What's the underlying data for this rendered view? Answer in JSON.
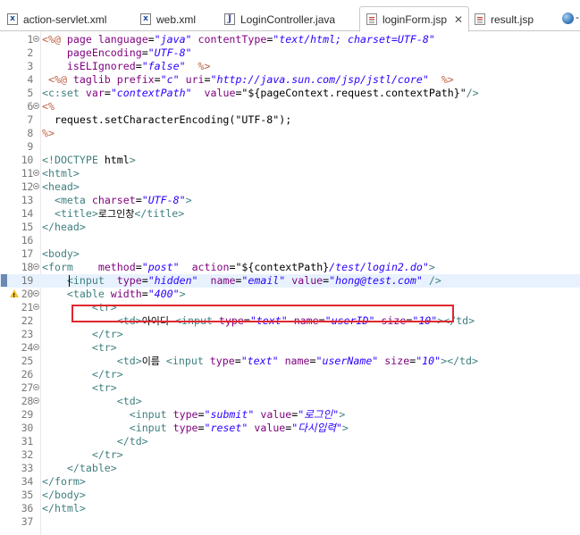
{
  "tabs": [
    {
      "label": "action-servlet.xml",
      "icon": "xml-file-icon",
      "active": false
    },
    {
      "label": "web.xml",
      "icon": "xml-file-icon",
      "active": false
    },
    {
      "label": "LoginController.java",
      "icon": "java-file-icon",
      "active": false
    },
    {
      "label": "loginForm.jsp",
      "icon": "jsp-file-icon",
      "active": true,
      "close": "✕"
    },
    {
      "label": "result.jsp",
      "icon": "jsp-file-icon",
      "active": false
    }
  ],
  "overflow_tab_icon": "web-browser-globe-icon",
  "overflow_mark": "-",
  "editor": {
    "current_line": 19,
    "warning_line": 20,
    "highlighted_line": 19,
    "highlight_color": "#e0262e",
    "lines": [
      {
        "n": "1",
        "fold": true,
        "spans": [
          [
            "jsp",
            "<%@ "
          ],
          [
            "attr",
            "page "
          ],
          [
            "attr",
            "language"
          ],
          [
            "p",
            "="
          ],
          [
            "val",
            "\"java\""
          ],
          [
            "p",
            " "
          ],
          [
            "attr",
            "contentType"
          ],
          [
            "p",
            "="
          ],
          [
            "val",
            "\"text/html; charset=UTF-8\""
          ]
        ]
      },
      {
        "n": "2",
        "spans": [
          [
            "p",
            "    "
          ],
          [
            "attr",
            "pageEncoding"
          ],
          [
            "p",
            "="
          ],
          [
            "val",
            "\"UTF-8\""
          ]
        ]
      },
      {
        "n": "3",
        "spans": [
          [
            "p",
            "    "
          ],
          [
            "attr",
            "isELIgnored"
          ],
          [
            "p",
            "="
          ],
          [
            "val",
            "\"false\""
          ],
          [
            "p",
            "  "
          ],
          [
            "jsp",
            "%>"
          ]
        ]
      },
      {
        "n": "4",
        "spans": [
          [
            "p",
            " "
          ],
          [
            "jsp",
            "<%@ "
          ],
          [
            "attr",
            "taglib "
          ],
          [
            "attr",
            "prefix"
          ],
          [
            "p",
            "="
          ],
          [
            "val",
            "\"c\""
          ],
          [
            "p",
            " "
          ],
          [
            "attr",
            "uri"
          ],
          [
            "p",
            "="
          ],
          [
            "val",
            "\"http://java.sun.com/jsp/jstl/core\""
          ],
          [
            "p",
            "  "
          ],
          [
            "jsp",
            "%>"
          ]
        ]
      },
      {
        "n": "5",
        "spans": [
          [
            "tag",
            "<c:set "
          ],
          [
            "attr",
            "var"
          ],
          [
            "p",
            "="
          ],
          [
            "val",
            "\"contextPath\""
          ],
          [
            "p",
            "  "
          ],
          [
            "attr",
            "value"
          ],
          [
            "p",
            "="
          ],
          [
            "p",
            "\"${pageContext.request.contextPath}\""
          ],
          [
            "tag",
            "/>"
          ]
        ]
      },
      {
        "n": "6",
        "fold": true,
        "spans": [
          [
            "jsp",
            "<%"
          ]
        ]
      },
      {
        "n": "7",
        "spans": [
          [
            "p",
            "  request.setCharacterEncoding(\"UTF-8\");"
          ]
        ]
      },
      {
        "n": "8",
        "spans": [
          [
            "jsp",
            "%>"
          ]
        ]
      },
      {
        "n": "9",
        "spans": []
      },
      {
        "n": "10",
        "spans": [
          [
            "doctype",
            "<!DOCTYPE "
          ],
          [
            "p",
            "html"
          ],
          [
            "doctype",
            ">"
          ]
        ]
      },
      {
        "n": "11",
        "fold": true,
        "spans": [
          [
            "tag",
            "<html>"
          ]
        ]
      },
      {
        "n": "12",
        "fold": true,
        "spans": [
          [
            "tag",
            "<head>"
          ]
        ]
      },
      {
        "n": "13",
        "spans": [
          [
            "p",
            "  "
          ],
          [
            "tag",
            "<meta "
          ],
          [
            "attr",
            "charset"
          ],
          [
            "p",
            "="
          ],
          [
            "val",
            "\"UTF-8\""
          ],
          [
            "tag",
            ">"
          ]
        ]
      },
      {
        "n": "14",
        "spans": [
          [
            "p",
            "  "
          ],
          [
            "tag",
            "<title>"
          ],
          [
            "ko",
            "로그인창"
          ],
          [
            "tag",
            "</title>"
          ]
        ]
      },
      {
        "n": "15",
        "spans": [
          [
            "tag",
            "</head>"
          ]
        ]
      },
      {
        "n": "16",
        "spans": []
      },
      {
        "n": "17",
        "spans": [
          [
            "tag",
            "<body>"
          ]
        ]
      },
      {
        "n": "18",
        "fold": true,
        "spans": [
          [
            "tag",
            "<form "
          ],
          [
            "p",
            "   "
          ],
          [
            "attr",
            "method"
          ],
          [
            "p",
            "="
          ],
          [
            "val",
            "\"post\""
          ],
          [
            "p",
            "  "
          ],
          [
            "attr",
            "action"
          ],
          [
            "p",
            "="
          ],
          [
            "p",
            "\"${contextPath}"
          ],
          [
            "val",
            "/test/login2.do\""
          ],
          [
            "tag",
            ">"
          ]
        ]
      },
      {
        "n": "19",
        "spans": [
          [
            "p",
            "    "
          ],
          [
            "tag",
            "<input "
          ],
          [
            "p",
            " "
          ],
          [
            "attr",
            "type"
          ],
          [
            "p",
            "="
          ],
          [
            "val",
            "\"hidden\""
          ],
          [
            "p",
            "  "
          ],
          [
            "attr",
            "name"
          ],
          [
            "p",
            "="
          ],
          [
            "val",
            "\"email\""
          ],
          [
            "p",
            " "
          ],
          [
            "attr",
            "value"
          ],
          [
            "p",
            "="
          ],
          [
            "val",
            "\"hong@test.com\""
          ],
          [
            "p",
            " "
          ],
          [
            "tag",
            "/>"
          ]
        ]
      },
      {
        "n": "20",
        "fold": true,
        "warn": true,
        "spans": [
          [
            "p",
            "    "
          ],
          [
            "tag",
            "<table "
          ],
          [
            "attr",
            "width"
          ],
          [
            "p",
            "="
          ],
          [
            "val",
            "\"400\""
          ],
          [
            "tag",
            ">"
          ]
        ]
      },
      {
        "n": "21",
        "fold": true,
        "spans": [
          [
            "p",
            "        "
          ],
          [
            "tag",
            "<tr>"
          ]
        ]
      },
      {
        "n": "22",
        "spans": [
          [
            "p",
            "            "
          ],
          [
            "tag",
            "<td>"
          ],
          [
            "ko",
            "아이디"
          ],
          [
            "p",
            " "
          ],
          [
            "tag",
            "<input "
          ],
          [
            "attr",
            "type"
          ],
          [
            "p",
            "="
          ],
          [
            "val",
            "\"text\""
          ],
          [
            "p",
            " "
          ],
          [
            "attr",
            "name"
          ],
          [
            "p",
            "="
          ],
          [
            "val",
            "\"userID\""
          ],
          [
            "p",
            " "
          ],
          [
            "attr",
            "size"
          ],
          [
            "p",
            "="
          ],
          [
            "val",
            "\"10\""
          ],
          [
            "tag",
            "></td>"
          ]
        ]
      },
      {
        "n": "23",
        "spans": [
          [
            "p",
            "        "
          ],
          [
            "tag",
            "</tr>"
          ]
        ]
      },
      {
        "n": "24",
        "fold": true,
        "spans": [
          [
            "p",
            "        "
          ],
          [
            "tag",
            "<tr>"
          ]
        ]
      },
      {
        "n": "25",
        "spans": [
          [
            "p",
            "            "
          ],
          [
            "tag",
            "<td>"
          ],
          [
            "ko",
            "이름"
          ],
          [
            "p",
            " "
          ],
          [
            "tag",
            "<input "
          ],
          [
            "attr",
            "type"
          ],
          [
            "p",
            "="
          ],
          [
            "val",
            "\"text\""
          ],
          [
            "p",
            " "
          ],
          [
            "attr",
            "name"
          ],
          [
            "p",
            "="
          ],
          [
            "val",
            "\"userName\""
          ],
          [
            "p",
            " "
          ],
          [
            "attr",
            "size"
          ],
          [
            "p",
            "="
          ],
          [
            "val",
            "\"10\""
          ],
          [
            "tag",
            "></td>"
          ]
        ]
      },
      {
        "n": "26",
        "spans": [
          [
            "p",
            "        "
          ],
          [
            "tag",
            "</tr>"
          ]
        ]
      },
      {
        "n": "27",
        "fold": true,
        "spans": [
          [
            "p",
            "        "
          ],
          [
            "tag",
            "<tr>"
          ]
        ]
      },
      {
        "n": "28",
        "fold": true,
        "spans": [
          [
            "p",
            "            "
          ],
          [
            "tag",
            "<td>"
          ]
        ]
      },
      {
        "n": "29",
        "spans": [
          [
            "p",
            "              "
          ],
          [
            "tag",
            "<input "
          ],
          [
            "attr",
            "type"
          ],
          [
            "p",
            "="
          ],
          [
            "val",
            "\"submit\""
          ],
          [
            "p",
            " "
          ],
          [
            "attr",
            "value"
          ],
          [
            "p",
            "="
          ],
          [
            "val",
            "\"로그인\""
          ],
          [
            "tag",
            ">"
          ]
        ]
      },
      {
        "n": "30",
        "spans": [
          [
            "p",
            "              "
          ],
          [
            "tag",
            "<input "
          ],
          [
            "attr",
            "type"
          ],
          [
            "p",
            "="
          ],
          [
            "val",
            "\"reset\""
          ],
          [
            "p",
            " "
          ],
          [
            "attr",
            "value"
          ],
          [
            "p",
            "="
          ],
          [
            "val",
            "\"다시입력\""
          ],
          [
            "tag",
            ">"
          ]
        ]
      },
      {
        "n": "31",
        "spans": [
          [
            "p",
            "            "
          ],
          [
            "tag",
            "</td>"
          ]
        ]
      },
      {
        "n": "32",
        "spans": [
          [
            "p",
            "        "
          ],
          [
            "tag",
            "</tr>"
          ]
        ]
      },
      {
        "n": "33",
        "spans": [
          [
            "p",
            "    "
          ],
          [
            "tag",
            "</table>"
          ]
        ]
      },
      {
        "n": "34",
        "spans": [
          [
            "tag",
            "</form>"
          ]
        ]
      },
      {
        "n": "35",
        "spans": [
          [
            "tag",
            "</body>"
          ]
        ]
      },
      {
        "n": "36",
        "spans": [
          [
            "tag",
            "</html>"
          ]
        ]
      },
      {
        "n": "37",
        "spans": []
      }
    ]
  }
}
